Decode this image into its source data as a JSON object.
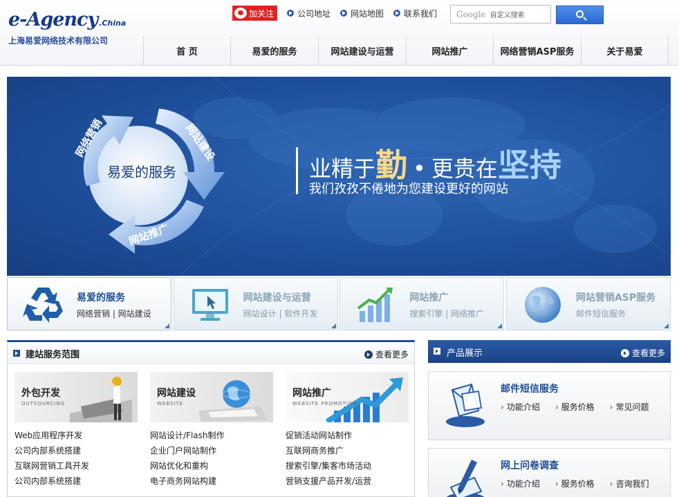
{
  "header": {
    "logo_main": "e-Agency",
    "logo_sub": ".China",
    "company": "上海易爱网络技术有限公司",
    "weibo_label": "加关注",
    "links": [
      "公司地址",
      "网站地图",
      "联系我们"
    ],
    "search": {
      "brand": "Google",
      "placeholder": "自定义搜索"
    }
  },
  "nav": [
    {
      "label": "首  页",
      "width": 126
    },
    {
      "label": "易爱的服务",
      "width": 127
    },
    {
      "label": "网站建设与运营",
      "width": 127
    },
    {
      "label": "网站推广",
      "width": 126
    },
    {
      "label": "网络营销ASP服务",
      "width": 127
    },
    {
      "label": "关于易爱",
      "width": 127
    }
  ],
  "banner": {
    "cycle_center": "易爱的服务",
    "cycle_labels": [
      "网络营销",
      "网站建设",
      "网站推广"
    ],
    "slogan_a": "业精于",
    "slogan_b": "勤",
    "slogan_dot": "•",
    "slogan_c": "更贵在",
    "slogan_d": "坚持",
    "slogan_sub": "我们孜孜不倦地为您建设更好的网站"
  },
  "tiles": [
    {
      "title": "易爱的服务",
      "sub": "网络营销  |  网站建设",
      "icon": "recycle-icon",
      "active": true
    },
    {
      "title": "网站建设与运营",
      "sub": "网站设计  |  软件开发",
      "icon": "monitor-icon",
      "active": false
    },
    {
      "title": "网站推广",
      "sub": "搜索引擎  |  网络推广",
      "icon": "growth-chart-icon",
      "active": false
    },
    {
      "title": "网站营销ASP服务",
      "sub": "邮件短信服务",
      "icon": "globe-icon",
      "active": false
    }
  ],
  "services_box": {
    "title": "建站服务范围",
    "more": "查看更多",
    "columns": [
      {
        "title": "外包开发",
        "en": "OUTSOURCING",
        "items": [
          "Web应用程序开发",
          "公司内部系统搭建",
          "互联网营销工具开发",
          "公司内部系统搭建"
        ]
      },
      {
        "title": "网站建设",
        "en": "WEBSITE",
        "items": [
          "网站设计/Flash制作",
          "企业门户网站制作",
          "网站优化和重构",
          "电子商务网站构建"
        ]
      },
      {
        "title": "网站推广",
        "en": "WEBSITE PROMOTION",
        "items": [
          "促销活动网站制作",
          "互联网商务推广",
          "搜索引擎/集客市场活动",
          "营销支援产品开发/运营"
        ]
      }
    ]
  },
  "products_box": {
    "title": "产品展示",
    "more": "查看更多",
    "products": [
      {
        "title": "邮件短信服务",
        "links": [
          "功能介绍",
          "服务价格",
          "常见问题"
        ],
        "icon": "mail-icon"
      },
      {
        "title": "网上问卷调查",
        "links": [
          "功能介绍",
          "服务价格",
          "咨询我们"
        ],
        "icon": "survey-pen-icon"
      }
    ]
  },
  "colors": {
    "brand_blue": "#1e4f9a",
    "accent_blue": "#2a6ad6",
    "weibo_red": "#e02020"
  }
}
